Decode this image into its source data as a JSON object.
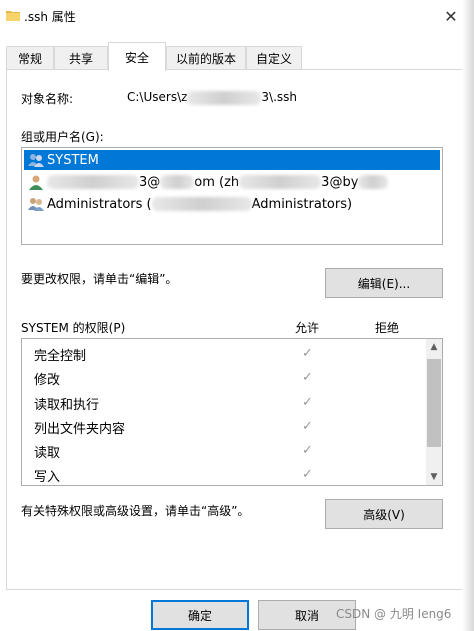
{
  "window": {
    "title": ".ssh 属性",
    "close_icon": "✕"
  },
  "tabs": [
    "常规",
    "共享",
    "安全",
    "以前的版本",
    "自定义"
  ],
  "active_tab": 2,
  "object": {
    "label": "对象名称:",
    "value_prefix": "C:\\Users\\z",
    "value_suffix": "3\\.ssh"
  },
  "groups": {
    "label": "组或用户名(G):",
    "items": [
      {
        "name": "SYSTEM"
      },
      {
        "prefix": "",
        "mid1": "3@",
        "mid2": "om (zh",
        "mid3": "3@by",
        "suffix": ""
      },
      {
        "prefix": "Administrators (",
        "suffix": "Administrators)"
      }
    ]
  },
  "edit_hint": "要更改权限，请单击“编辑”。",
  "edit_button": "编辑(E)...",
  "permissions": {
    "label": "SYSTEM 的权限(P)",
    "allow_header": "允许",
    "deny_header": "拒绝",
    "items": [
      "完全控制",
      "修改",
      "读取和执行",
      "列出文件夹内容",
      "读取",
      "写入"
    ],
    "allowed": [
      true,
      true,
      true,
      true,
      true,
      true
    ],
    "check_glyph": "✓"
  },
  "advanced_hint": "有关特殊权限或高级设置，请单击“高级”。",
  "advanced_button": "高级(V)",
  "footer": {
    "ok": "确定",
    "cancel": "取消"
  },
  "watermark": "CSDN @ 九明 Ieng6",
  "colors": {
    "selection": "#0078d7",
    "check": "#9a9a9a"
  }
}
